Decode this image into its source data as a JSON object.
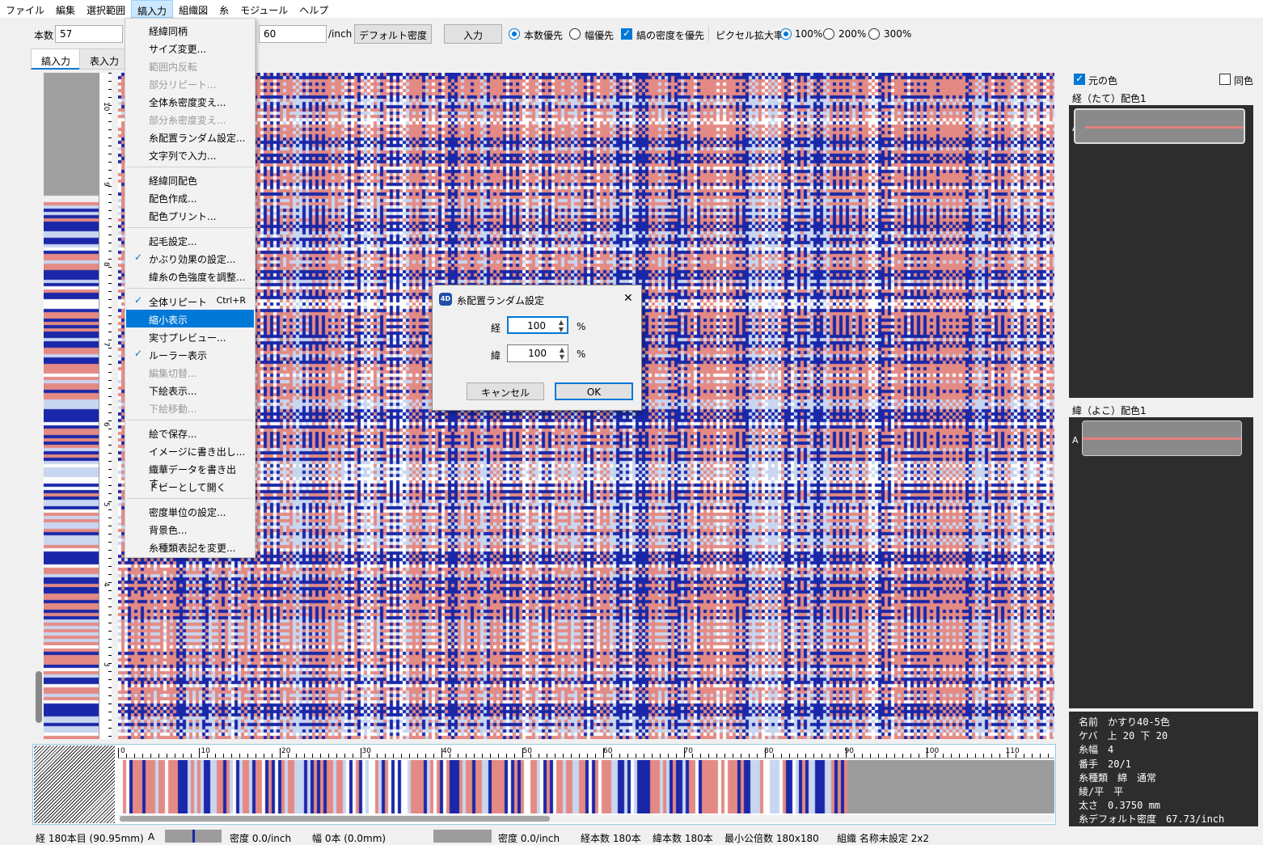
{
  "menubar": {
    "items": [
      "ファイル",
      "編集",
      "選択範囲",
      "縞入力",
      "組織図",
      "糸",
      "モジュール",
      "ヘルプ"
    ],
    "active": "縞入力"
  },
  "toolbar": {
    "count_label": "本数",
    "count_value": "57",
    "density_value": "60",
    "density_unit": "/inch",
    "default_density_btn": "デフォルト密度",
    "input_btn": "入力",
    "radio_count_priority": "本数優先",
    "radio_width_priority": "幅優先",
    "check_stripe_density": "縞の密度を優先",
    "pixel_zoom_label": "ピクセル拡大率",
    "zoom_options": [
      "100%",
      "200%",
      "300%"
    ],
    "zoom_selected": "100%"
  },
  "tabs": [
    {
      "label": "縞入力",
      "active": true
    },
    {
      "label": "表入力",
      "active": false
    }
  ],
  "dropdown": {
    "items": [
      {
        "label": "経緯同柄",
        "state": "normal",
        "checked": false
      },
      {
        "label": "サイズ変更...",
        "state": "normal",
        "checked": false
      },
      {
        "label": "範囲内反転",
        "state": "disabled",
        "checked": false
      },
      {
        "label": "部分リピート...",
        "state": "disabled",
        "checked": false
      },
      {
        "label": "全体糸密度変え...",
        "state": "normal",
        "checked": false
      },
      {
        "label": "部分糸密度変え...",
        "state": "disabled",
        "checked": false
      },
      {
        "label": "糸配置ランダム設定...",
        "state": "normal",
        "checked": false
      },
      {
        "label": "文字列で入力...",
        "state": "normal",
        "checked": false
      },
      {
        "label": "経緯同配色",
        "state": "normal",
        "checked": false
      },
      {
        "label": "配色作成...",
        "state": "normal",
        "checked": false
      },
      {
        "label": "配色プリント...",
        "state": "normal",
        "checked": false
      },
      {
        "label": "起毛設定...",
        "state": "normal",
        "checked": false
      },
      {
        "label": "かぶり効果の設定...",
        "state": "normal",
        "checked": true
      },
      {
        "label": "緯糸の色強度を調整...",
        "state": "normal",
        "checked": false
      },
      {
        "label": "全体リピート",
        "state": "normal",
        "checked": true,
        "shortcut": "Ctrl+R"
      },
      {
        "label": "縮小表示",
        "state": "highlight",
        "checked": false
      },
      {
        "label": "実寸プレビュー...",
        "state": "normal",
        "checked": false
      },
      {
        "label": "ルーラー表示",
        "state": "normal",
        "checked": true
      },
      {
        "label": "編集切替...",
        "state": "disabled",
        "checked": false
      },
      {
        "label": "下絵表示...",
        "state": "normal",
        "checked": false
      },
      {
        "label": "下絵移動...",
        "state": "disabled",
        "checked": false
      },
      {
        "label": "絵で保存...",
        "state": "normal",
        "checked": false
      },
      {
        "label": "イメージに書き出し...",
        "state": "normal",
        "checked": false
      },
      {
        "label": "織華データを書き出す...",
        "state": "normal",
        "checked": false
      },
      {
        "label": "ドビーとして開く",
        "state": "normal",
        "checked": false
      },
      {
        "label": "密度単位の設定...",
        "state": "normal",
        "checked": false
      },
      {
        "label": "背景色...",
        "state": "normal",
        "checked": false
      },
      {
        "label": "糸種類表記を変更...",
        "state": "normal",
        "checked": false
      }
    ]
  },
  "dialog": {
    "icon": "4D",
    "title": "糸配置ランダム設定",
    "close_glyph": "✕",
    "warp_label": "経",
    "warp_value": "100",
    "weft_label": "緯",
    "weft_value": "100",
    "unit": "%",
    "cancel_label": "キャンセル",
    "ok_label": "OK"
  },
  "vruler_labels": [
    "10",
    "9",
    "8",
    "7",
    "6",
    "5",
    "4",
    "3"
  ],
  "hruler_labels": [
    "0",
    "10",
    "20",
    "30",
    "40",
    "50",
    "60",
    "70",
    "80",
    "90",
    "100",
    "110"
  ],
  "right_panel": {
    "original_color": "元の色",
    "original_checked": true,
    "same_color": "同色",
    "same_checked": false,
    "warp_scheme": "経（たて）配色1",
    "weft_scheme": "緯（よこ）配色1",
    "swatch_letter": "A",
    "info": [
      "名前　かすり40-5色",
      "ケバ　上 20 下 20",
      "糸幅　4",
      "番手　20/1",
      "糸種類　綿　通常",
      "綾/平　平",
      "太さ　0.3750 mm",
      "糸デフォルト密度　67.73/inch"
    ]
  },
  "statusbar": {
    "warp_pos": "経 180本目 (90.95mm)",
    "letter": "A",
    "density1": "密度 0.0/inch",
    "width": "幅 0本 (0.0mm)",
    "density2": "密度 0.0/inch",
    "warp_count": "経本数 180本",
    "weft_count": "緯本数 180本",
    "lcm": "最小公倍数 180x180",
    "weave": "組織 名称未設定 2x2"
  },
  "colors": {
    "blue": "#1a27a8",
    "salmon": "#e48a84",
    "pale": "#c9d6f0",
    "white": "#ffffff",
    "accent": "#0078d7"
  }
}
